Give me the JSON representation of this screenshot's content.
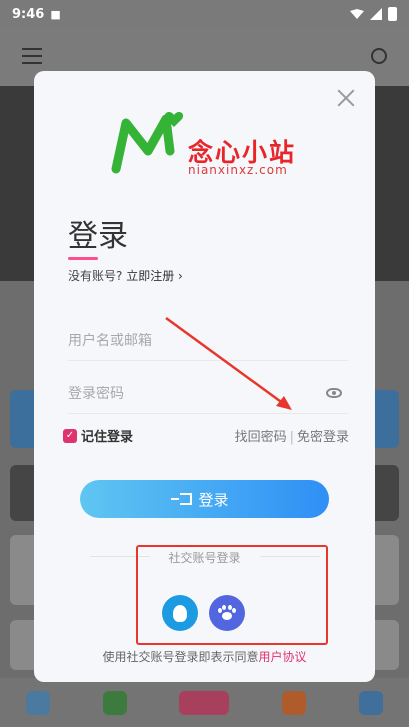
{
  "status": {
    "time": "9:46"
  },
  "modal": {
    "logo_cn": "念心小站",
    "logo_en": "nianxinxz.com",
    "title": "登录",
    "no_account": "没有账号?",
    "register_link": "立即注册",
    "username_placeholder": "用户名或邮箱",
    "password_placeholder": "登录密码",
    "remember": "记住登录",
    "forgot": "找回密码",
    "passwordless": "免密登录",
    "login_button": "登录",
    "social_title": "社交账号登录",
    "agreement_prefix": "使用社交账号登录即表示同意",
    "agreement_link": "用户协议"
  },
  "icons": [
    "close-icon",
    "eye-icon",
    "login-icon",
    "qq-icon",
    "baidu-icon",
    "menu-icon",
    "search-icon"
  ],
  "colors": {
    "accent_pink": "#e0336d",
    "button_start": "#5fc6f2",
    "button_end": "#2f8ff5",
    "logo_green": "#35b336",
    "annotation_red": "#e8362b"
  }
}
